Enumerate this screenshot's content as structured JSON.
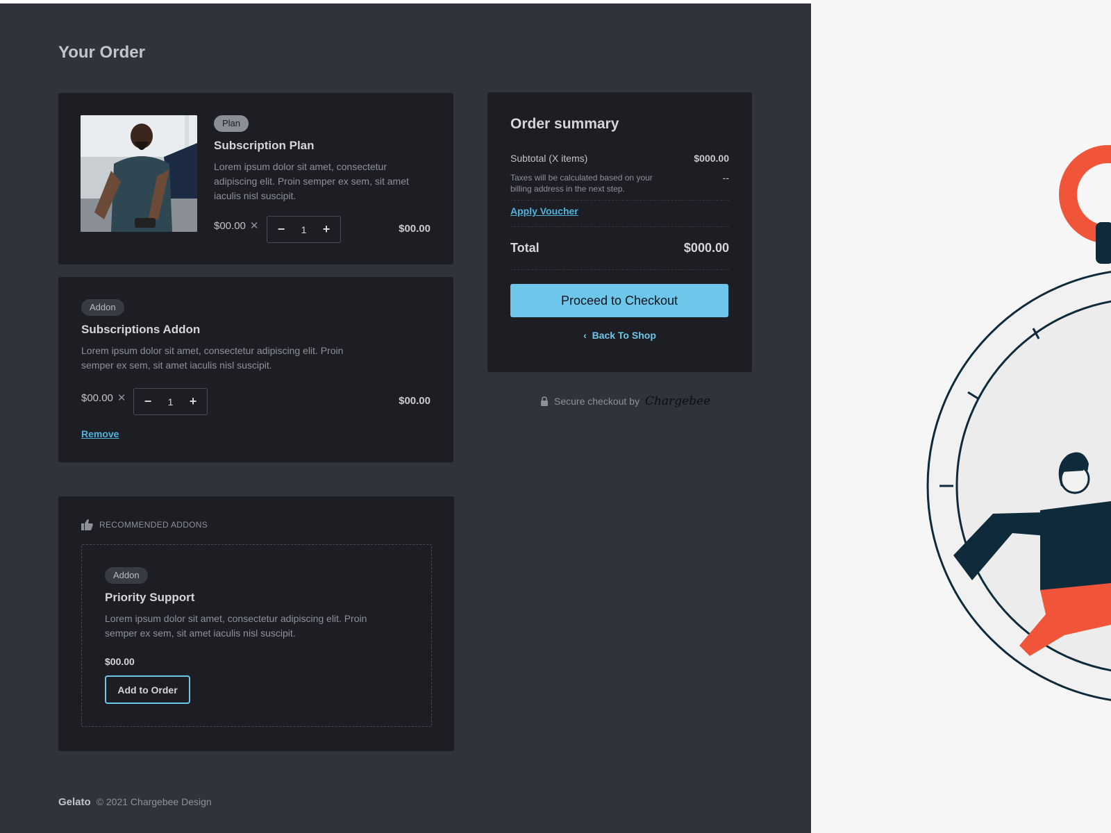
{
  "page": {
    "title": "Your Order"
  },
  "plan_item": {
    "badge": "Plan",
    "title": "Subscription Plan",
    "description": "Lorem ipsum dolor sit amet, consectetur adipiscing elit. Proin semper ex sem, sit amet iaculis nisl suscipit.",
    "unit_price": "$00.00",
    "quantity": "1",
    "total": "$00.00"
  },
  "addon_item": {
    "badge": "Addon",
    "title": "Subscriptions Addon",
    "description": "Lorem ipsum dolor sit amet, consectetur adipiscing elit. Proin semper ex sem, sit amet iaculis nisl suscipit.",
    "unit_price": "$00.00",
    "quantity": "1",
    "total": "$00.00",
    "remove_label": "Remove"
  },
  "recommended": {
    "heading": "RECOMMENDED ADDONS",
    "badge": "Addon",
    "title": "Priority Support",
    "description": "Lorem ipsum dolor sit amet, consectetur adipiscing elit. Proin semper ex sem, sit amet iaculis nisl suscipit.",
    "price": "$00.00",
    "add_label": "Add to Order"
  },
  "summary": {
    "title": "Order summary",
    "subtotal_label": "Subtotal (X items)",
    "subtotal_value": "$000.00",
    "tax_note": "Taxes will be calculated based on your billing address in the next step.",
    "tax_value": "--",
    "voucher_label": "Apply Voucher",
    "total_label": "Total",
    "total_value": "$000.00",
    "checkout_label": "Proceed to Checkout",
    "back_label": "Back To Shop"
  },
  "secure": {
    "text": "Secure checkout by",
    "brand": "Chargebee"
  },
  "footer": {
    "brand": "Gelato",
    "copyright": "© 2021 Chargebee Design"
  },
  "colors": {
    "accent": "#6ec6ea",
    "link": "#4fb3dd",
    "panel_bg": "#30333c",
    "card_bg": "#1d1e23",
    "illustration_red": "#f0553a",
    "illustration_navy": "#0f2a3a"
  },
  "icons": [
    "minus-icon",
    "plus-icon",
    "close-icon",
    "thumbs-up-icon",
    "chevron-left-icon",
    "lock-icon"
  ]
}
